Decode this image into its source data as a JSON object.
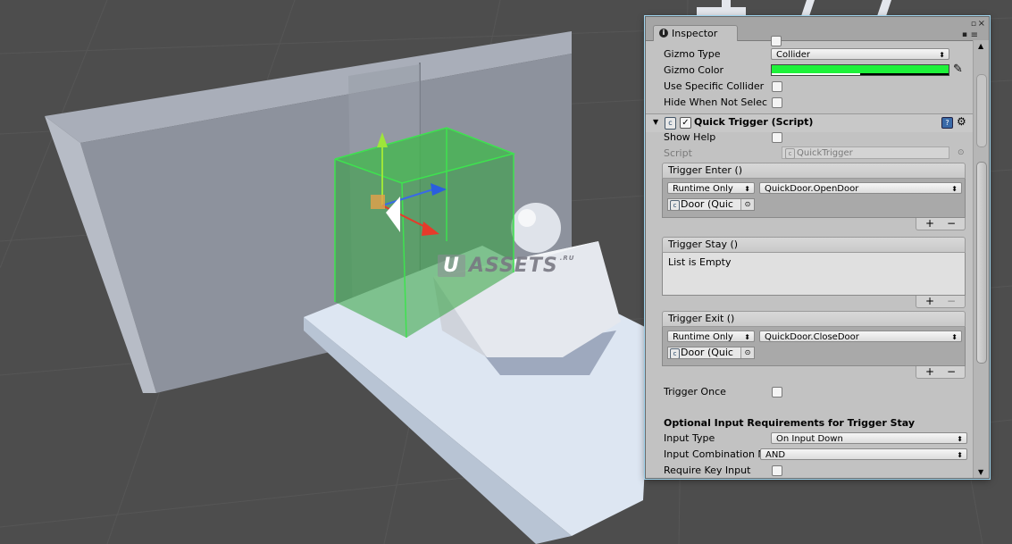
{
  "watermark": {
    "u": "U",
    "text": "ASSETS",
    "suffix": ".RU"
  },
  "inspector": {
    "tab_label": "Inspector",
    "icons": {
      "info": "info-icon",
      "lock": "lock-icon",
      "menu": "menu-icon",
      "maximize": "maximize-icon",
      "close": "close-icon"
    },
    "fields": {
      "gizmo_type_label": "Gizmo Type",
      "gizmo_type_value": "Collider",
      "gizmo_color_label": "Gizmo Color",
      "gizmo_color_hex": "#1ef23a",
      "use_specific_collider_label": "Use Specific Collider",
      "hide_when_not_selected_label": "Hide When Not Selec"
    },
    "component": {
      "title": "Quick Trigger (Script)",
      "show_help_label": "Show Help",
      "script_label": "Script",
      "script_value": "QuickTrigger"
    },
    "events": {
      "enter": {
        "title": "Trigger Enter ()",
        "mode": "Runtime Only",
        "function": "QuickDoor.OpenDoor",
        "target": "Door (Quic"
      },
      "stay": {
        "title": "Trigger Stay ()",
        "empty_text": "List is Empty"
      },
      "exit": {
        "title": "Trigger Exit ()",
        "mode": "Runtime Only",
        "function": "QuickDoor.CloseDoor",
        "target": "Door (Quic"
      },
      "plus": "+",
      "minus": "−"
    },
    "trigger_once_label": "Trigger Once",
    "optional_section_title": "Optional Input Requirements for Trigger Stay",
    "input_type_label": "Input Type",
    "input_type_value": "On Input Down",
    "input_combination_label": "Input Combination M",
    "input_combination_value": "AND",
    "require_key_input_label": "Require Key Input"
  }
}
